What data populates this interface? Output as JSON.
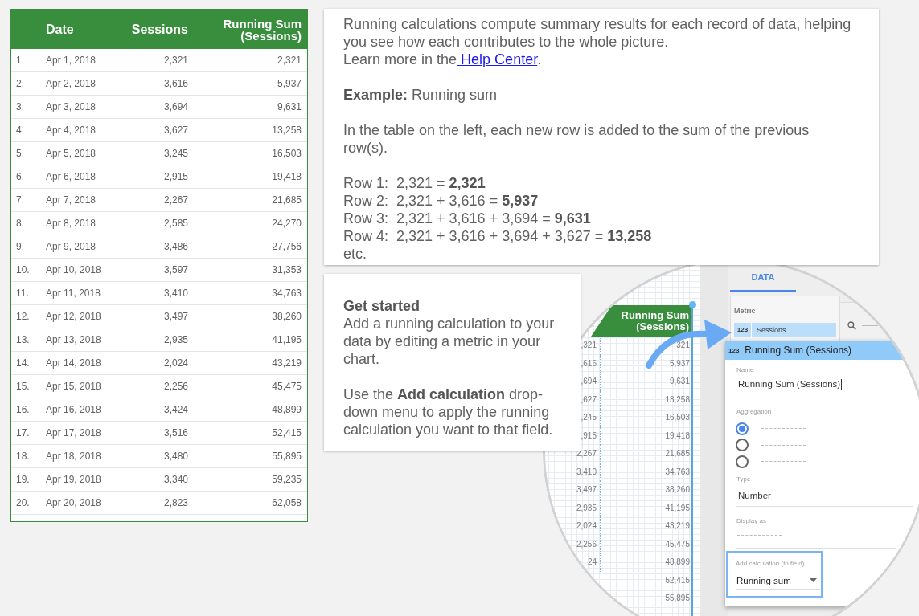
{
  "table": {
    "columns": [
      {
        "label": "Date"
      },
      {
        "label": "Sessions"
      },
      {
        "label": "Running Sum (Sessions)"
      }
    ],
    "rows": [
      {
        "index": "1.",
        "date": "Apr 1, 2018",
        "sessions": "2,321",
        "running_sum": "2,321"
      },
      {
        "index": "2.",
        "date": "Apr 2, 2018",
        "sessions": "3,616",
        "running_sum": "5,937"
      },
      {
        "index": "3.",
        "date": "Apr 3, 2018",
        "sessions": "3,694",
        "running_sum": "9,631"
      },
      {
        "index": "4.",
        "date": "Apr 4, 2018",
        "sessions": "3,627",
        "running_sum": "13,258"
      },
      {
        "index": "5.",
        "date": "Apr 5, 2018",
        "sessions": "3,245",
        "running_sum": "16,503"
      },
      {
        "index": "6.",
        "date": "Apr 6, 2018",
        "sessions": "2,915",
        "running_sum": "19,418"
      },
      {
        "index": "7.",
        "date": "Apr 7, 2018",
        "sessions": "2,267",
        "running_sum": "21,685"
      },
      {
        "index": "8.",
        "date": "Apr 8, 2018",
        "sessions": "2,585",
        "running_sum": "24,270"
      },
      {
        "index": "9.",
        "date": "Apr 9, 2018",
        "sessions": "3,486",
        "running_sum": "27,756"
      },
      {
        "index": "10.",
        "date": "Apr 10, 2018",
        "sessions": "3,597",
        "running_sum": "31,353"
      },
      {
        "index": "11.",
        "date": "Apr 11, 2018",
        "sessions": "3,410",
        "running_sum": "34,763"
      },
      {
        "index": "12.",
        "date": "Apr 12, 2018",
        "sessions": "3,497",
        "running_sum": "38,260"
      },
      {
        "index": "13.",
        "date": "Apr 13, 2018",
        "sessions": "2,935",
        "running_sum": "41,195"
      },
      {
        "index": "14.",
        "date": "Apr 14, 2018",
        "sessions": "2,024",
        "running_sum": "43,219"
      },
      {
        "index": "15.",
        "date": "Apr 15, 2018",
        "sessions": "2,256",
        "running_sum": "45,475"
      },
      {
        "index": "16.",
        "date": "Apr 16, 2018",
        "sessions": "3,424",
        "running_sum": "48,899"
      },
      {
        "index": "17.",
        "date": "Apr 17, 2018",
        "sessions": "3,516",
        "running_sum": "52,415"
      },
      {
        "index": "18.",
        "date": "Apr 18, 2018",
        "sessions": "3,480",
        "running_sum": "55,895"
      },
      {
        "index": "19.",
        "date": "Apr 19, 2018",
        "sessions": "3,340",
        "running_sum": "59,235"
      },
      {
        "index": "20.",
        "date": "Apr 20, 2018",
        "sessions": "2,823",
        "running_sum": "62,058"
      }
    ]
  },
  "info_card": {
    "intro": "Running calculations compute summary results for each record of data, helping you see how each contributes to the whole picture.",
    "learn_more": {
      "text": "Learn more in the",
      "link": "Help Center",
      "end": "."
    },
    "example": "**Example:** Running sum",
    "description": "In the table on the left, each new row is added to the sum of the previous row(s).",
    "calculation_rows": [
      "Row 1:  2,321 = **2,321**",
      "Row 2:  2,321 + 3,616 = **5,937**",
      "Row 3:  2,321 + 3,616 + 3,694 = **9,631**",
      "Row 4:  2,321 + 3,616 + 3,694 + 3,627 = **13,258**"
    ],
    "closing": "etc."
  },
  "get_started_card": {
    "title": "Get started",
    "paragraphs": [
      "Add a running calculation to your data by editing a metric in your chart.",
      "Use the **Add calculation** drop-down menu to apply the running calculation you want to that field."
    ]
  },
  "magnifier": {
    "canvas_column": {
      "header": "Running Sum (Sessions)",
      "left_values": [
        ",321",
        ",616",
        ",694",
        ",627",
        ",245",
        ",915",
        "2,267",
        "3,410",
        "3,497",
        "2,935",
        "2,024",
        "2,256",
        "24"
      ],
      "right_values": [
        "321",
        "5,937",
        "9,631",
        "13,258",
        "16,503",
        "19,418",
        "21,685",
        "34,763",
        "38,260",
        "41,195",
        "43,219",
        "45,475",
        "48,899",
        "52,415",
        "55,895"
      ]
    },
    "data_panel": {
      "tabs": [
        {
          "label": "DATA",
          "selected": true
        }
      ],
      "section_label": "Metric",
      "metric_chip": {
        "type_label": "123",
        "name": "Sessions"
      }
    },
    "field_editor": {
      "type_label": "123",
      "title": "Running Sum (Sessions)",
      "name": {
        "label": "Name",
        "value": "Running Sum (Sessions)",
        "focused": true
      },
      "aggregation": {
        "label": "Aggregation",
        "options": [
          {
            "selected": true
          },
          {
            "selected": false
          },
          {
            "selected": false
          }
        ]
      },
      "type": {
        "label": "Type",
        "value": "Number"
      },
      "display_as": {
        "label": "Display as"
      },
      "add_calculation": {
        "label": "Add calculation (to field)",
        "value": "Running sum",
        "highlighted": true
      }
    }
  }
}
